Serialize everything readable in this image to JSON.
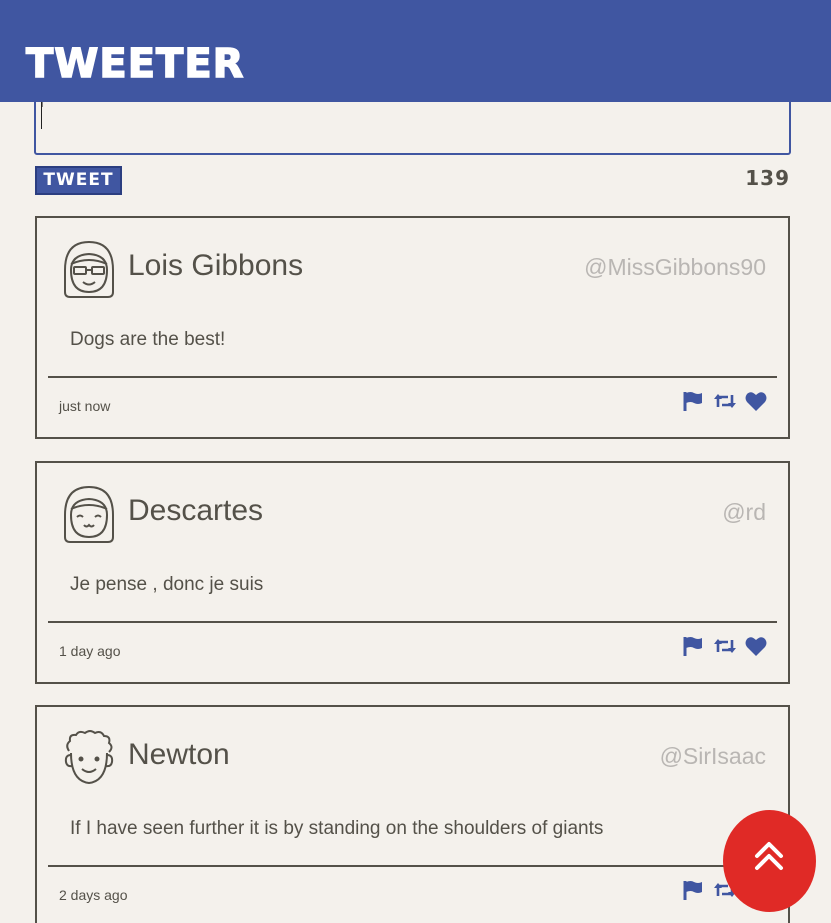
{
  "nav": {
    "brand": "Tweeter"
  },
  "composer": {
    "placeholder": "",
    "value": ""
  },
  "tweet_button": {
    "label": "Tweet"
  },
  "counter": {
    "value": "139"
  },
  "tweets": [
    {
      "name": "Lois Gibbons",
      "handle": "@MissGibbons90",
      "text": "Dogs are the best!",
      "time": "just now",
      "avatar": "girl-glasses-avatar"
    },
    {
      "name": "Descartes",
      "handle": "@rd",
      "text": "Je pense , donc je suis",
      "time": "1 day ago",
      "avatar": "smiling-face-avatar"
    },
    {
      "name": "Newton",
      "handle": "@SirIsaac",
      "text": "If I have seen further it is by standing on the shoulders of giants",
      "time": "2 days ago",
      "avatar": "curly-hair-avatar"
    }
  ],
  "icons": {
    "flag": "flag-icon",
    "retweet": "retweet-icon",
    "like": "heart-icon",
    "scroll_top": "double-chevron-up-icon"
  },
  "colors": {
    "nav": "#4056a1",
    "text": "#545149",
    "handle": "#b9b6b3",
    "accent_red": "#e02a26",
    "background": "#f4f1ec"
  }
}
